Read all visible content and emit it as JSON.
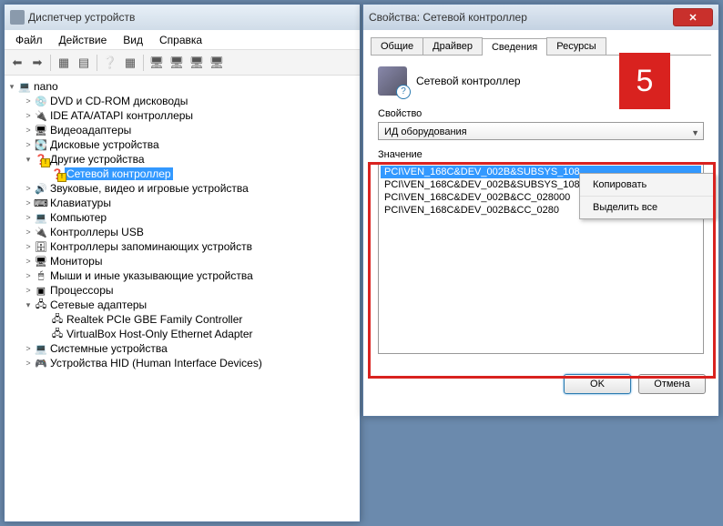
{
  "devmgr": {
    "title": "Диспетчер устройств",
    "menu": [
      "Файл",
      "Действие",
      "Вид",
      "Справка"
    ],
    "root": "nano",
    "nodes": [
      {
        "label": "DVD и CD-ROM дисководы",
        "expand": ">",
        "indent": 1,
        "icon": "💿"
      },
      {
        "label": "IDE ATA/ATAPI контроллеры",
        "expand": ">",
        "indent": 1,
        "icon": "🔌"
      },
      {
        "label": "Видеоадаптеры",
        "expand": ">",
        "indent": 1,
        "icon": "🖥"
      },
      {
        "label": "Дисковые устройства",
        "expand": ">",
        "indent": 1,
        "icon": "💽"
      },
      {
        "label": "Другие устройства",
        "expand": "▾",
        "indent": 1,
        "icon": "❓",
        "warn": true
      },
      {
        "label": "Сетевой контроллер",
        "expand": "",
        "indent": 2,
        "icon": "❓",
        "warn": true,
        "selected": true
      },
      {
        "label": "Звуковые, видео и игровые устройства",
        "expand": ">",
        "indent": 1,
        "icon": "🔊"
      },
      {
        "label": "Клавиатуры",
        "expand": ">",
        "indent": 1,
        "icon": "⌨"
      },
      {
        "label": "Компьютер",
        "expand": ">",
        "indent": 1,
        "icon": "💻"
      },
      {
        "label": "Контроллеры USB",
        "expand": ">",
        "indent": 1,
        "icon": "🔌"
      },
      {
        "label": "Контроллеры запоминающих устройств",
        "expand": ">",
        "indent": 1,
        "icon": "🗄"
      },
      {
        "label": "Мониторы",
        "expand": ">",
        "indent": 1,
        "icon": "🖥"
      },
      {
        "label": "Мыши и иные указывающие устройства",
        "expand": ">",
        "indent": 1,
        "icon": "🖱"
      },
      {
        "label": "Процессоры",
        "expand": ">",
        "indent": 1,
        "icon": "▣"
      },
      {
        "label": "Сетевые адаптеры",
        "expand": "▾",
        "indent": 1,
        "icon": "🖧"
      },
      {
        "label": "Realtek PCIe GBE Family Controller",
        "expand": "",
        "indent": 2,
        "icon": "🖧"
      },
      {
        "label": "VirtualBox Host-Only Ethernet Adapter",
        "expand": "",
        "indent": 2,
        "icon": "🖧"
      },
      {
        "label": "Системные устройства",
        "expand": ">",
        "indent": 1,
        "icon": "💻"
      },
      {
        "label": "Устройства HID (Human Interface Devices)",
        "expand": ">",
        "indent": 1,
        "icon": "🎮"
      }
    ]
  },
  "props": {
    "title": "Свойства: Сетевой контроллер",
    "tabs": [
      "Общие",
      "Драйвер",
      "Сведения",
      "Ресурсы"
    ],
    "active_tab": 2,
    "device_name": "Сетевой контроллер",
    "property_label": "Свойство",
    "combo_value": "ИД оборудования",
    "value_label": "Значение",
    "values": [
      "PCI\\VEN_168C&DEV_002B&SUBSYS_108",
      "PCI\\VEN_168C&DEV_002B&SUBSYS_108",
      "PCI\\VEN_168C&DEV_002B&CC_028000",
      "PCI\\VEN_168C&DEV_002B&CC_0280"
    ],
    "ok": "OK",
    "cancel": "Отмена"
  },
  "ctx": {
    "copy": "Копировать",
    "selectall": "Выделить все"
  },
  "badge": "5"
}
